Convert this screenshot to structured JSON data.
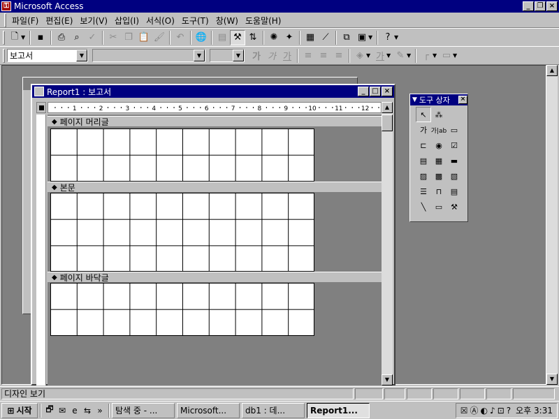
{
  "app": {
    "title": "Microsoft Access"
  },
  "menu": [
    "파일(F)",
    "편집(E)",
    "보기(V)",
    "삽입(I)",
    "서식(O)",
    "도구(T)",
    "창(W)",
    "도움말(H)"
  ],
  "format_bar": {
    "object_combo": "보고서",
    "bold": "가",
    "italic": "가",
    "underline": "가"
  },
  "report_window": {
    "title": "Report1 : 보고서"
  },
  "ruler": {
    "h_marks": [
      "1",
      "2",
      "3",
      "4",
      "5",
      "6",
      "7",
      "8",
      "9",
      "10",
      "11",
      "12"
    ]
  },
  "sections": {
    "page_header": "페이지 머리글",
    "detail": "본문",
    "page_footer": "페이지 바닥글"
  },
  "toolbox": {
    "title": "도구 상자",
    "label_tool": "가",
    "textbox_tool": "가|ab"
  },
  "status": {
    "text": "디자인 보기"
  },
  "taskbar": {
    "start": "시작",
    "tasks": [
      "탐색 중 - ...",
      "Microsoft...",
      "db1 : 데...",
      "Report1..."
    ],
    "clock": "오후 3:31"
  }
}
